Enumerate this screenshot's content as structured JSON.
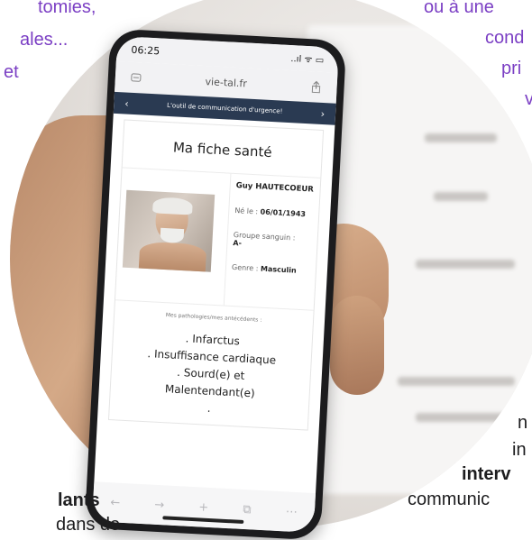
{
  "background_text": {
    "top_left_1": "tomies,",
    "top_left_2": "ales...",
    "top_left_3": "et",
    "top_right_1": "ou à une",
    "top_right_2": "cond",
    "top_right_3": "pri",
    "top_right_4": "v",
    "bottom_left_bold": "lants",
    "bottom_left": "dans de",
    "bottom_right_1": "n",
    "bottom_right_2": "in",
    "bottom_right_bold": "interv",
    "bottom_right_3": "communic"
  },
  "phone": {
    "status": {
      "time": "06:25",
      "icons": "..ıl ᯤ ▭"
    },
    "url": "vie-tal.fr",
    "navbar_title": "L'outil de communication d'urgence!",
    "nav_prev": "‹",
    "nav_next": "›",
    "page_title": "Ma fiche santé",
    "profile": {
      "name": "Guy HAUTECOEUR",
      "born_label": "Né le : ",
      "born_value": "06/01/1943",
      "blood_label": "Groupe sanguin :",
      "blood_value": "A-",
      "gender_label": "Genre : ",
      "gender_value": "Masculin"
    },
    "pathologies_header": "Mes pathologies/mes antécédents :",
    "pathologies": [
      ". Infarctus",
      ". Insuffisance cardiaque",
      ". Sourd(e) et",
      "Malentendant(e)",
      "."
    ],
    "bottom_icons": [
      "←",
      "→",
      "+",
      "⧉",
      "⋯"
    ]
  }
}
